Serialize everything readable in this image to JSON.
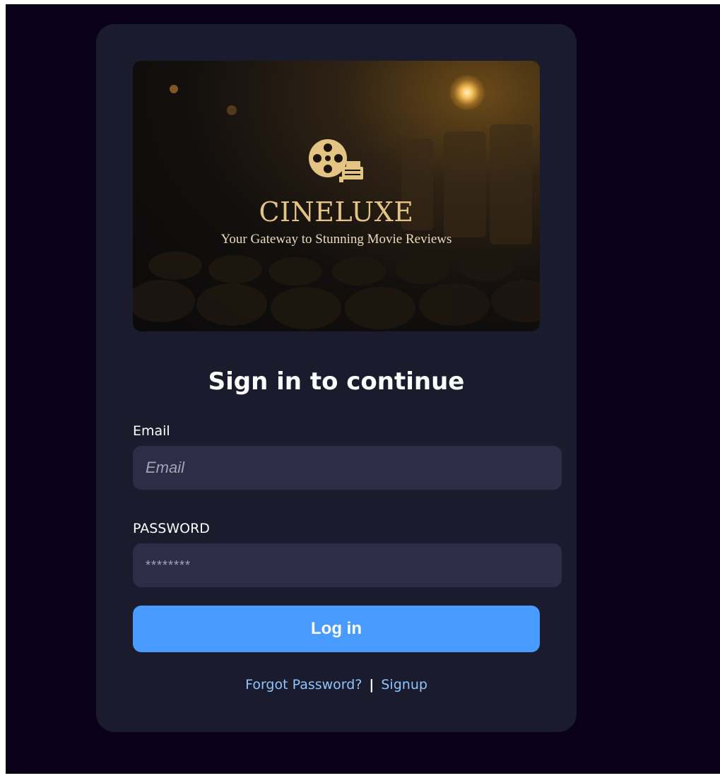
{
  "hero": {
    "brand": "CINELUXE",
    "tagline": "Your Gateway to Stunning Movie Reviews",
    "icon": "film-reel-icon"
  },
  "form": {
    "heading": "Sign in to continue",
    "email_label": "Email",
    "email_placeholder": "Email",
    "password_label": "PASSWORD",
    "password_placeholder": "********",
    "login_label": "Log in"
  },
  "links": {
    "forgot": "Forgot Password?",
    "separator": "|",
    "signup": "Signup"
  },
  "colors": {
    "background": "#0a0019",
    "card": "#1a1b2d",
    "input": "#2d2d47",
    "button": "#4a9bff",
    "link": "#8ec5ff",
    "brand_gold": "#e3c482"
  }
}
